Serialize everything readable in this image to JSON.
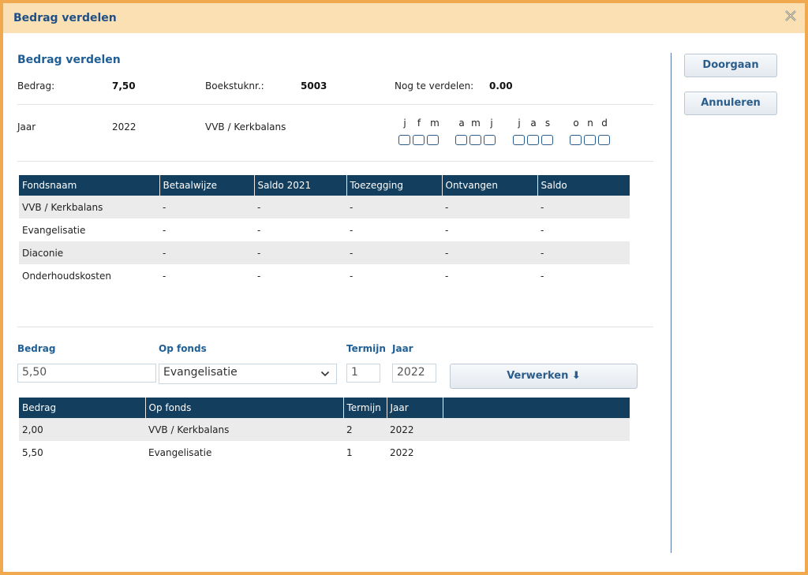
{
  "window": {
    "title": "Bedrag verdelen"
  },
  "summary": {
    "title": "Bedrag verdelen",
    "bedrag_label": "Bedrag:",
    "bedrag_value": "7,50",
    "boekstuk_label": "Boekstuknr.:",
    "boekstuk_value": "5003",
    "nog_label": "Nog te verdelen:",
    "nog_value": "0.00",
    "jaar_label": "Jaar",
    "jaar_value": "2022",
    "fonds_name": "VVB / Kerkbalans"
  },
  "months": [
    "j",
    "f",
    "m",
    "a",
    "m",
    "j",
    "j",
    "a",
    "s",
    "o",
    "n",
    "d"
  ],
  "funds_table": {
    "columns": [
      "Fondsnaam",
      "Betaalwijze",
      "Saldo 2021",
      "Toezegging",
      "Ontvangen",
      "Saldo"
    ],
    "rows": [
      [
        "VVB / Kerkbalans",
        "-",
        "-",
        "-",
        "-",
        "-"
      ],
      [
        "Evangelisatie",
        "-",
        "-",
        "-",
        "-",
        "-"
      ],
      [
        "Diaconie",
        "-",
        "-",
        "-",
        "-",
        "-"
      ],
      [
        "Onderhoudskosten",
        "-",
        "-",
        "-",
        "-",
        "-"
      ]
    ]
  },
  "form": {
    "bedrag_label": "Bedrag",
    "bedrag_value": "5,50",
    "fonds_label": "Op fonds",
    "fonds_value": "Evangelisatie",
    "termijn_label": "Termijn",
    "termijn_value": "1",
    "jaar_label": "Jaar",
    "jaar_value": "2022",
    "verwerken_label": "Verwerken ⬇"
  },
  "alloc_table": {
    "columns": [
      "Bedrag",
      "Op fonds",
      "Termijn",
      "Jaar",
      ""
    ],
    "rows": [
      [
        "2,00",
        "VVB / Kerkbalans",
        "2",
        "2022",
        ""
      ],
      [
        "5,50",
        "Evangelisatie",
        "1",
        "2022",
        ""
      ]
    ]
  },
  "actions": {
    "doorgaan": "Doorgaan",
    "annuleren": "Annuleren"
  },
  "colors": {
    "accent": "#1f5f96",
    "header_bg": "#133e5e",
    "frame": "#f0a94e",
    "titlebar": "#fae0b2"
  }
}
